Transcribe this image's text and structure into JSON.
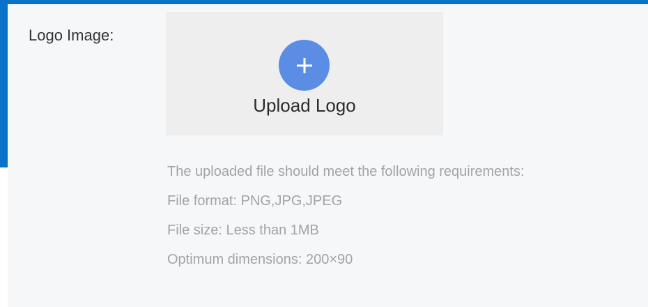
{
  "form": {
    "logo_label": "Logo Image:",
    "upload_button_label": "Upload Logo",
    "upload_icon": "plus-icon",
    "requirements": [
      "The uploaded file should meet the following requirements:",
      "File format: PNG,JPG,JPEG",
      "File size: Less than 1MB",
      "Optimum dimensions: 200×90"
    ]
  },
  "colors": {
    "accent_blue": "#0a73c8",
    "upload_icon_blue": "#5b8de4",
    "panel_background": "#f6f7f8",
    "upload_box_background": "#eeeeee",
    "hint_text": "#a3a3a3"
  }
}
